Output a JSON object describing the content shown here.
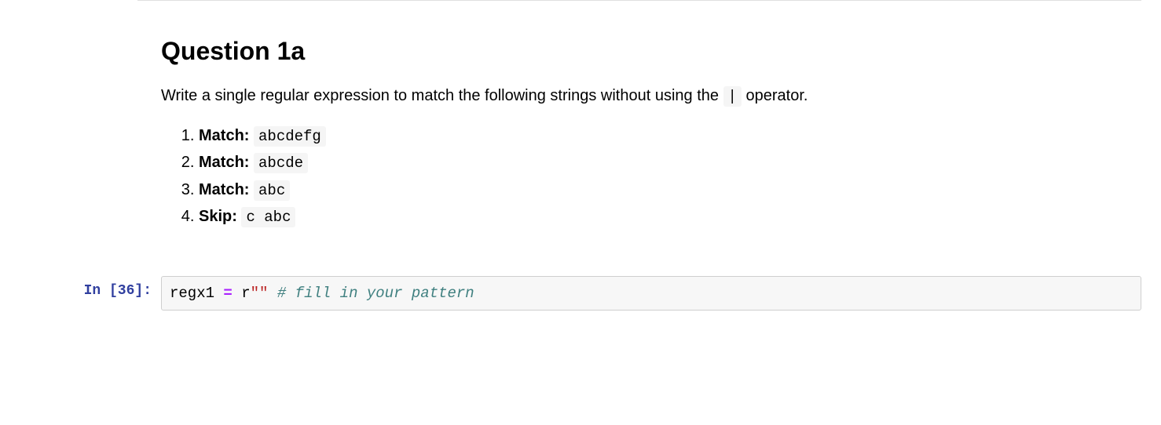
{
  "heading": "Question 1a",
  "instruction_pre": "Write a single regular expression to match the following strings without using the ",
  "instruction_op": "|",
  "instruction_post": " operator.",
  "items": [
    {
      "label": "Match:",
      "value": "abcdefg"
    },
    {
      "label": "Match:",
      "value": "abcde"
    },
    {
      "label": "Match:",
      "value": "abc"
    },
    {
      "label": "Skip:",
      "value": "c abc"
    }
  ],
  "code_cell": {
    "prompt_label": "In [36]:",
    "tokens": {
      "var": "regx1",
      "op": "=",
      "prefix": "r",
      "string": "\"\"",
      "comment": "# fill in your pattern"
    }
  }
}
